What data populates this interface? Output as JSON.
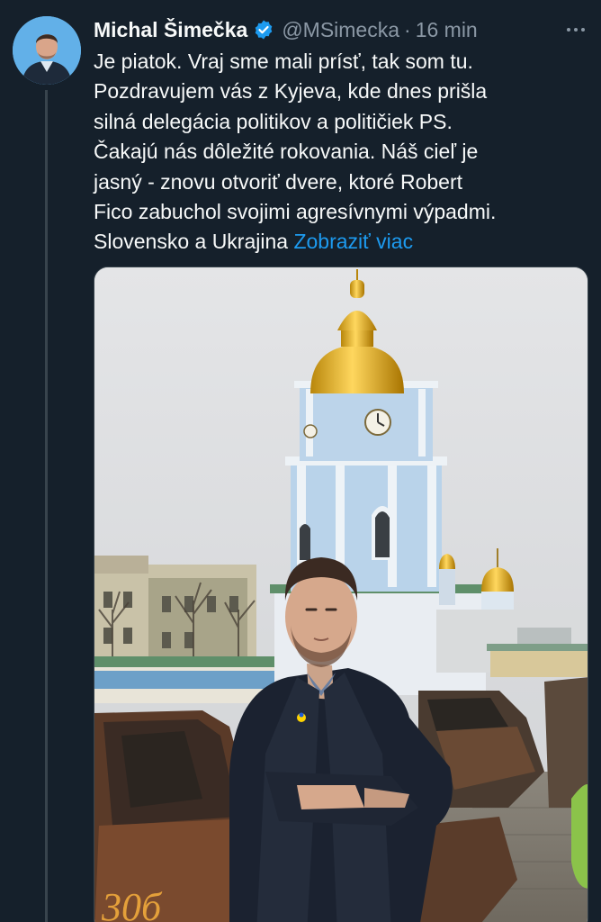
{
  "tweet": {
    "author": {
      "display_name": "Michal Šimečka",
      "handle": "@MSimecka",
      "verified": true,
      "avatar_icon": "profile-avatar"
    },
    "separator": "·",
    "time": "16 min",
    "more_icon": "more-horizontal-icon",
    "text_lines": [
      "Je piatok. Vraj sme mali prísť, tak som tu.",
      "Pozdravujem vás z Kyjeva, kde dnes prišla",
      "silná delegácia politikov a političiek PS.",
      "Čakajú nás dôležité rokovania. Náš cieľ je",
      "jasný - znovu otvoriť dvere, ktoré Robert",
      "Fico zabuchol svojimi agresívnymi výpadmi.",
      "Slovensko a Ukrajina "
    ],
    "show_more": "Zobraziť viac",
    "media": {
      "description_icon": "photo-kyiv-monastery-man",
      "graffiti_text": "30б"
    }
  },
  "colors": {
    "background": "#15202b",
    "text": "#f7f9f9",
    "muted": "#8b98a5",
    "link": "#1d9bf0",
    "thread_line": "#38444d"
  }
}
